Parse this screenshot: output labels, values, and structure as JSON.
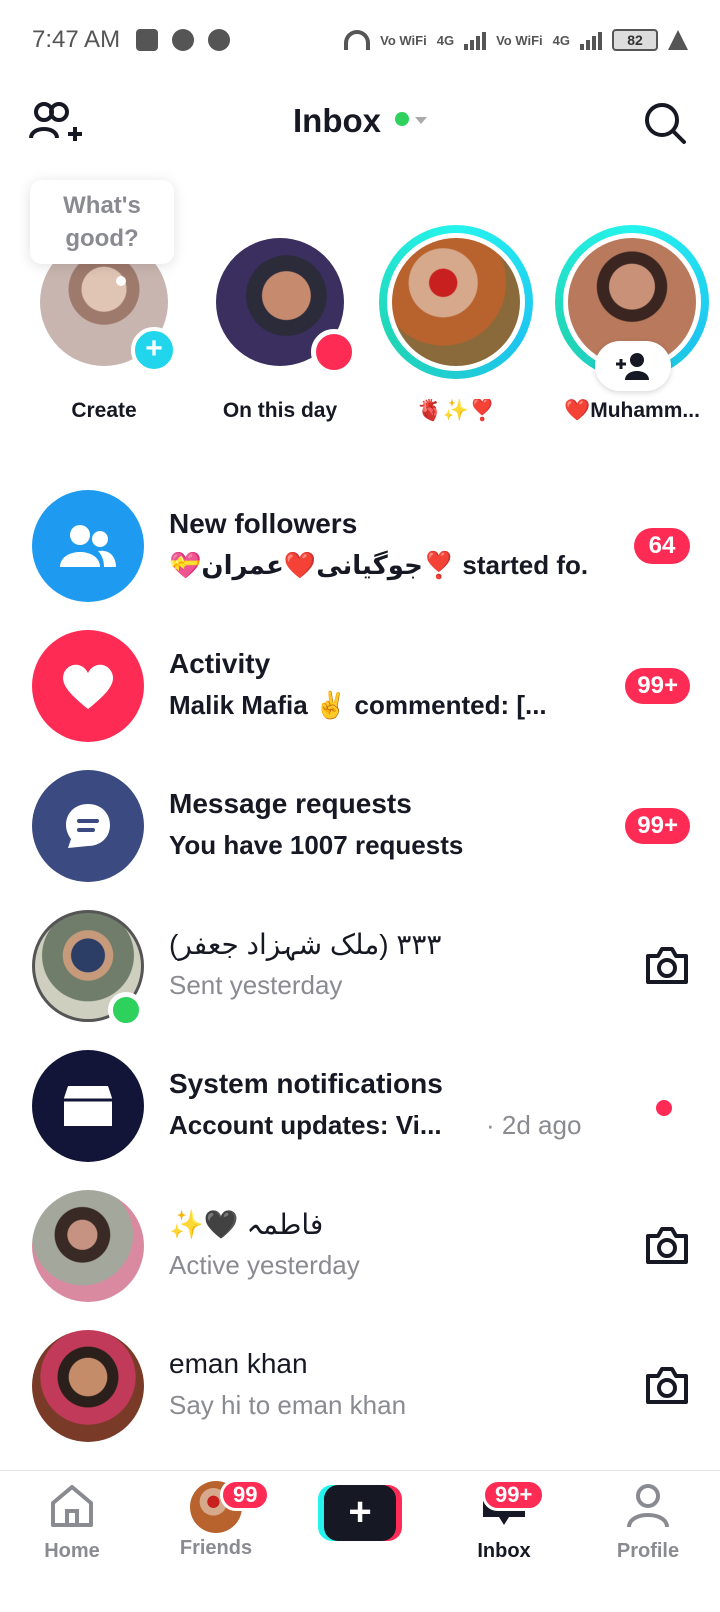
{
  "status_bar": {
    "time": "7:47 AM",
    "network_labels": [
      "Vo WiFi",
      "4G",
      "Vo WiFi",
      "4G"
    ],
    "battery": "82"
  },
  "header": {
    "title": "Inbox",
    "status_color": "#2ed15c"
  },
  "stories": {
    "bubble_text": "What's good?",
    "items": [
      {
        "label": "Create"
      },
      {
        "label": "On this day"
      },
      {
        "label": "🫀✨❣️"
      },
      {
        "label": "❤️Muhamm..."
      }
    ]
  },
  "list": [
    {
      "title": "New followers",
      "subtitle": "💝جوگیانی❤️عمران❣️ started fo...",
      "badge": "64",
      "icon": "followers-icon"
    },
    {
      "title": "Activity",
      "subtitle": "Malik Mafia ✌️ commented: [...",
      "badge": "99+",
      "icon": "heart-icon"
    },
    {
      "title": "Message requests",
      "subtitle": "You have 1007 requests",
      "badge": "99+",
      "icon": "message-icon"
    },
    {
      "title": "(ملک شہزاد جعفر) ٣٣٣",
      "subtitle": "Sent yesterday",
      "action": "camera-icon"
    },
    {
      "title": "System notifications",
      "subtitle": "Account updates: Vi...",
      "time": "· 2d ago",
      "icon": "inbox-box-icon"
    },
    {
      "title": "✨🖤 فاطمہ",
      "subtitle": "Active yesterday",
      "action": "camera-icon"
    },
    {
      "title": "eman khan",
      "subtitle": "Say hi to eman khan",
      "action": "camera-icon"
    }
  ],
  "bottom_nav": {
    "home": "Home",
    "friends": "Friends",
    "friends_badge": "99",
    "inbox": "Inbox",
    "inbox_badge": "99+",
    "profile": "Profile"
  },
  "colors": {
    "accent_red": "#fe2c55",
    "accent_cyan": "#25f4ee",
    "followers_blue": "#1e9bf0",
    "activity_pink": "#fe2c55",
    "requests_navy": "#3b4a80",
    "system_navy": "#121537"
  }
}
